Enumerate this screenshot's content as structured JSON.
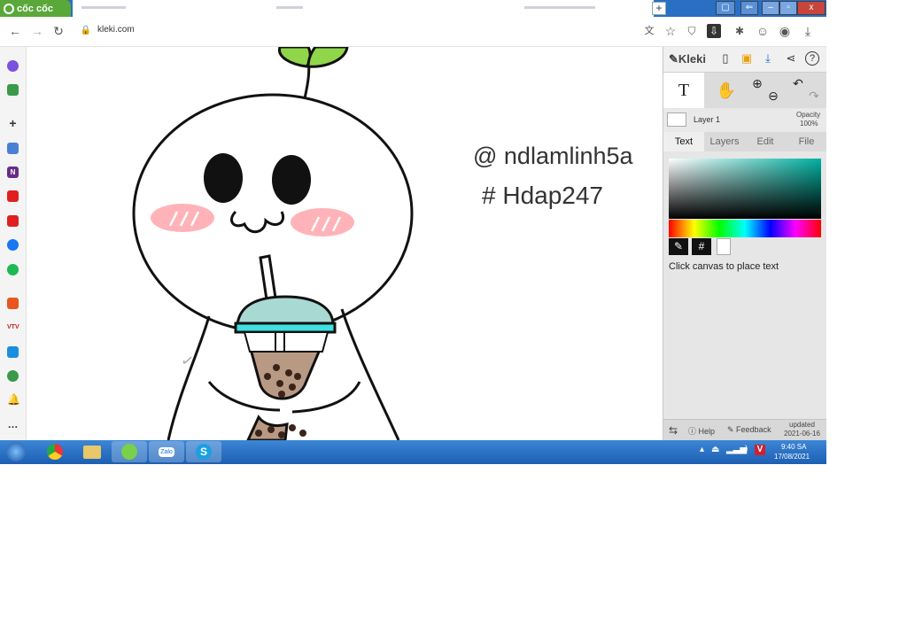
{
  "browser": {
    "brand": "cốc cốc",
    "url": "kleki.com"
  },
  "kleki": {
    "logo": "Kleki",
    "layer_name": "Layer 1",
    "opacity_label": "Opacity",
    "opacity_value": "100%",
    "tabs": [
      "Text",
      "Layers",
      "Edit",
      "File"
    ],
    "active_tab": "Text",
    "hex_symbol": "#",
    "hint": "Click canvas to place text",
    "footer": {
      "help": "Help",
      "feedback": "Feedback",
      "updated_label": "updated",
      "updated_date": "2021-06-16"
    }
  },
  "canvas": {
    "line1": "@ ndlamlinh5a",
    "line2": "# Hdap247",
    "blush": "///",
    "mouth": "ω"
  },
  "taskbar": {
    "time": "9:40 SA",
    "date": "17/08/2021",
    "apps": [
      "chrome-icon",
      "explorer-icon",
      "coccoc-icon",
      "zalo-icon",
      "skype-icon"
    ],
    "zalo_label": "Zalo",
    "skype_label": "S"
  },
  "colors": {
    "titlebar": "#2a6fc4",
    "brand": "#5aa83a",
    "taskbar": "#1c5fb3",
    "leaf": "#8fd64a",
    "cup_lid": "#a8d9d3",
    "cup_band": "#3ee0e0",
    "tea": "#b89a84",
    "blush": "#ff9aa0"
  }
}
